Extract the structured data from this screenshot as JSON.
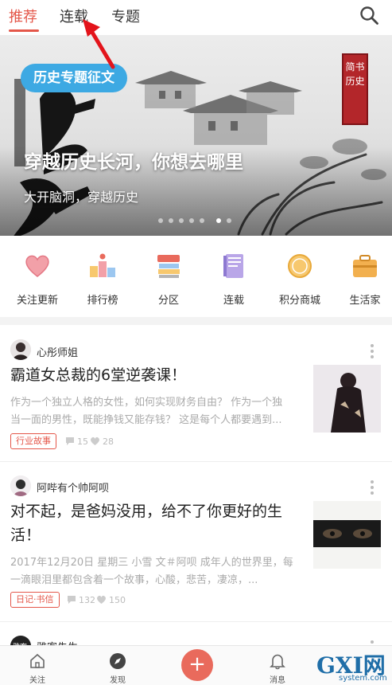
{
  "tabs": [
    {
      "label": "推荐",
      "active": true
    },
    {
      "label": "连载",
      "active": false
    },
    {
      "label": "专题",
      "active": false
    }
  ],
  "search": {
    "icon": "search-icon"
  },
  "banner": {
    "tag": "历史专题征文",
    "title": "穿越历史长河，你想去哪里",
    "subtitle": "大开脑洞，穿越历史",
    "seal_text": "简书历史",
    "dots_total": 7,
    "dots_active": 6
  },
  "shortcuts": [
    {
      "label": "关注更新",
      "icon": "heart-icon"
    },
    {
      "label": "排行榜",
      "icon": "podium-icon"
    },
    {
      "label": "分区",
      "icon": "books-icon"
    },
    {
      "label": "连载",
      "icon": "notebook-icon"
    },
    {
      "label": "积分商城",
      "icon": "coin-icon"
    },
    {
      "label": "生活家",
      "icon": "suitcase-icon"
    }
  ],
  "feed": [
    {
      "author": "心彤师姐",
      "title": "霸道女总裁的6堂逆袭课！",
      "excerpt_lines": [
        "作为一个独立人格的女性，如何实现财务自由？ 作为一个独",
        "当一面的男性，既能挣钱又能存钱？ 这是每个人都要遇到..."
      ],
      "tag": "行业故事",
      "comments": "15",
      "likes": "28"
    },
    {
      "author": "阿哔有个帅阿呗",
      "title_lines": [
        "对不起，是爸妈没用，给不了你更好的生",
        "活！"
      ],
      "excerpt_lines": [
        "2017年12月20日 星期三 小雪 文＃阿呗 成年人的世界里，每",
        "一滴眼泪里都包含着一个故事，心酸，悲苦，凄凉，..."
      ],
      "tag": "日记·书信",
      "comments": "132",
      "likes": "150"
    },
    {
      "author": "雅客先生"
    }
  ],
  "bottom_nav": [
    {
      "label": "关注",
      "icon": "home-icon"
    },
    {
      "label": "发现",
      "icon": "compass-icon"
    },
    {
      "label": "",
      "icon": "plus-icon"
    },
    {
      "label": "消息",
      "icon": "bell-icon"
    }
  ],
  "watermark": {
    "text": "GXI网",
    "sub": "system.com"
  },
  "colors": {
    "accent": "#e4574a",
    "tag_blue": "#3da9e3",
    "fab": "#e96a5c"
  }
}
